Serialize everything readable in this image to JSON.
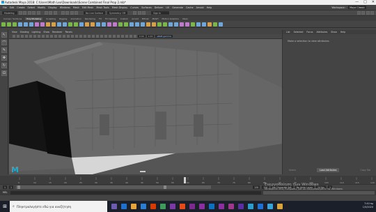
{
  "window": {
    "title": "Autodesk Maya 2018: C:\\Users\\Math Leo\\Downloads\\Scene Combined Final Prop 2.mb*",
    "controls": [
      "—",
      "□",
      "✕"
    ]
  },
  "menubar": {
    "items": [
      "File",
      "Edit",
      "Create",
      "Select",
      "Modify",
      "Display",
      "Windows",
      "Mesh",
      "Edit Mesh",
      "Mesh Tools",
      "Mesh Display",
      "Curves",
      "Surfaces",
      "Deform",
      "UV",
      "Generate",
      "Cache",
      "Arnold",
      "Help"
    ],
    "workspace_label": "Workspace :",
    "workspace_value": "Maya Classic"
  },
  "statusline": {
    "mode": "Modeling",
    "no_live_surface": "No Live Surface",
    "symmetry": "Symmetry: Off",
    "sign_in": "Sign In"
  },
  "shelf": {
    "tabs": [
      "Curves / Surfaces",
      "Poly Modeling",
      "Sculpting",
      "Rigging",
      "Animation",
      "Rendering",
      "FX",
      "FX Caching",
      "Custom",
      "Arnold",
      "Bifrost",
      "MASH",
      "Motion Graphics",
      "XGen"
    ],
    "active_tab": "Poly Modeling",
    "icon_colors": [
      "#7ab648",
      "#7ab648",
      "#7ab648",
      "#6fa7d8",
      "#6fa7d8",
      "#6fa7d8",
      "#c07acb",
      "#c07acb",
      "#d8a04a",
      "#d8a04a",
      "#6fa7d8",
      "#6fa7d8",
      "#7ab648",
      "#7ab648",
      "#6fa7d8",
      "#d8a04a",
      "#d8a04a",
      "#6fa7d8",
      "#6fa7d8",
      "#c07acb",
      "#c07acb",
      "#7ab648",
      "#7ab648",
      "#6fa7d8",
      "#6fa7d8",
      "#6fa7d8",
      "#d8a04a",
      "#d8a04a",
      "#7ab648",
      "#7ab648",
      "#6fa7d8",
      "#6fa7d8",
      "#c07acb",
      "#c07acb",
      "#7ab648",
      "#6fa7d8",
      "#6fa7d8",
      "#d8a04a",
      "#7ab648",
      "#6fa7d8"
    ]
  },
  "toolbox": {
    "tools": [
      "select-tool-icon",
      "lasso-tool-icon",
      "paint-select-icon",
      "move-tool-icon",
      "rotate-tool-icon",
      "scale-tool-icon"
    ],
    "glyphs": [
      "↖",
      "⌒",
      "✎",
      "✥",
      "↻",
      "⊡"
    ]
  },
  "viewport": {
    "menu": [
      "View",
      "Shading",
      "Lighting",
      "Show",
      "Renderer",
      "Panels"
    ],
    "field_value_1": "0.00",
    "field_value_2": "1.00",
    "color_space": "sRGB gamma",
    "maya_logo_letter": "M"
  },
  "attribute_editor": {
    "tabs": [
      "List",
      "Selected",
      "Focus",
      "Attributes",
      "Show",
      "Help"
    ],
    "message": "Make a selection to view attributes.",
    "buttons": [
      "Select",
      "Load Attributes",
      "Copy Tab"
    ],
    "active_button": "Load Attributes"
  },
  "timeline": {
    "range_start": "1",
    "range_end": "120",
    "anim_start": "1",
    "anim_end": "120",
    "current_frame_field": "1",
    "fps": "24 fps",
    "char_set": "No Character Set",
    "anim_layer": "No Anim Layer",
    "ticks": [
      "5",
      "10",
      "15",
      "20",
      "25",
      "30",
      "35",
      "40",
      "45",
      "50",
      "55",
      "60",
      "65",
      "70",
      "75",
      "80",
      "85",
      "90",
      "95",
      "100",
      "105",
      "110",
      "115",
      "120"
    ]
  },
  "command_line": {
    "label": "MEL"
  },
  "watermark": {
    "line1": "Ενεργοποίηση των Windows",
    "line2": "Μεταβείτε στις Ρυθμίσεις για να ενεργοποιήσετε τα Windows."
  },
  "taskbar": {
    "search_placeholder": "Πληκτρολογήστε εδώ για αναζήτηση",
    "app_colors": [
      "#6b5cb1",
      "#1f6fd0",
      "#e8a33a",
      "#2b7cd3",
      "#d83b01",
      "#3f9b5b",
      "#7a3aa8",
      "#e64a19",
      "#7c2a8f",
      "#8b2fa0",
      "#0c6fc2",
      "#8b2fa0",
      "#a0378c",
      "#5a2fa0",
      "#2a9dcc",
      "#1f6fd0",
      "#3aa2d8",
      "#d9a23a"
    ],
    "time": "7:40 πμ",
    "date": "1/5/2020"
  }
}
